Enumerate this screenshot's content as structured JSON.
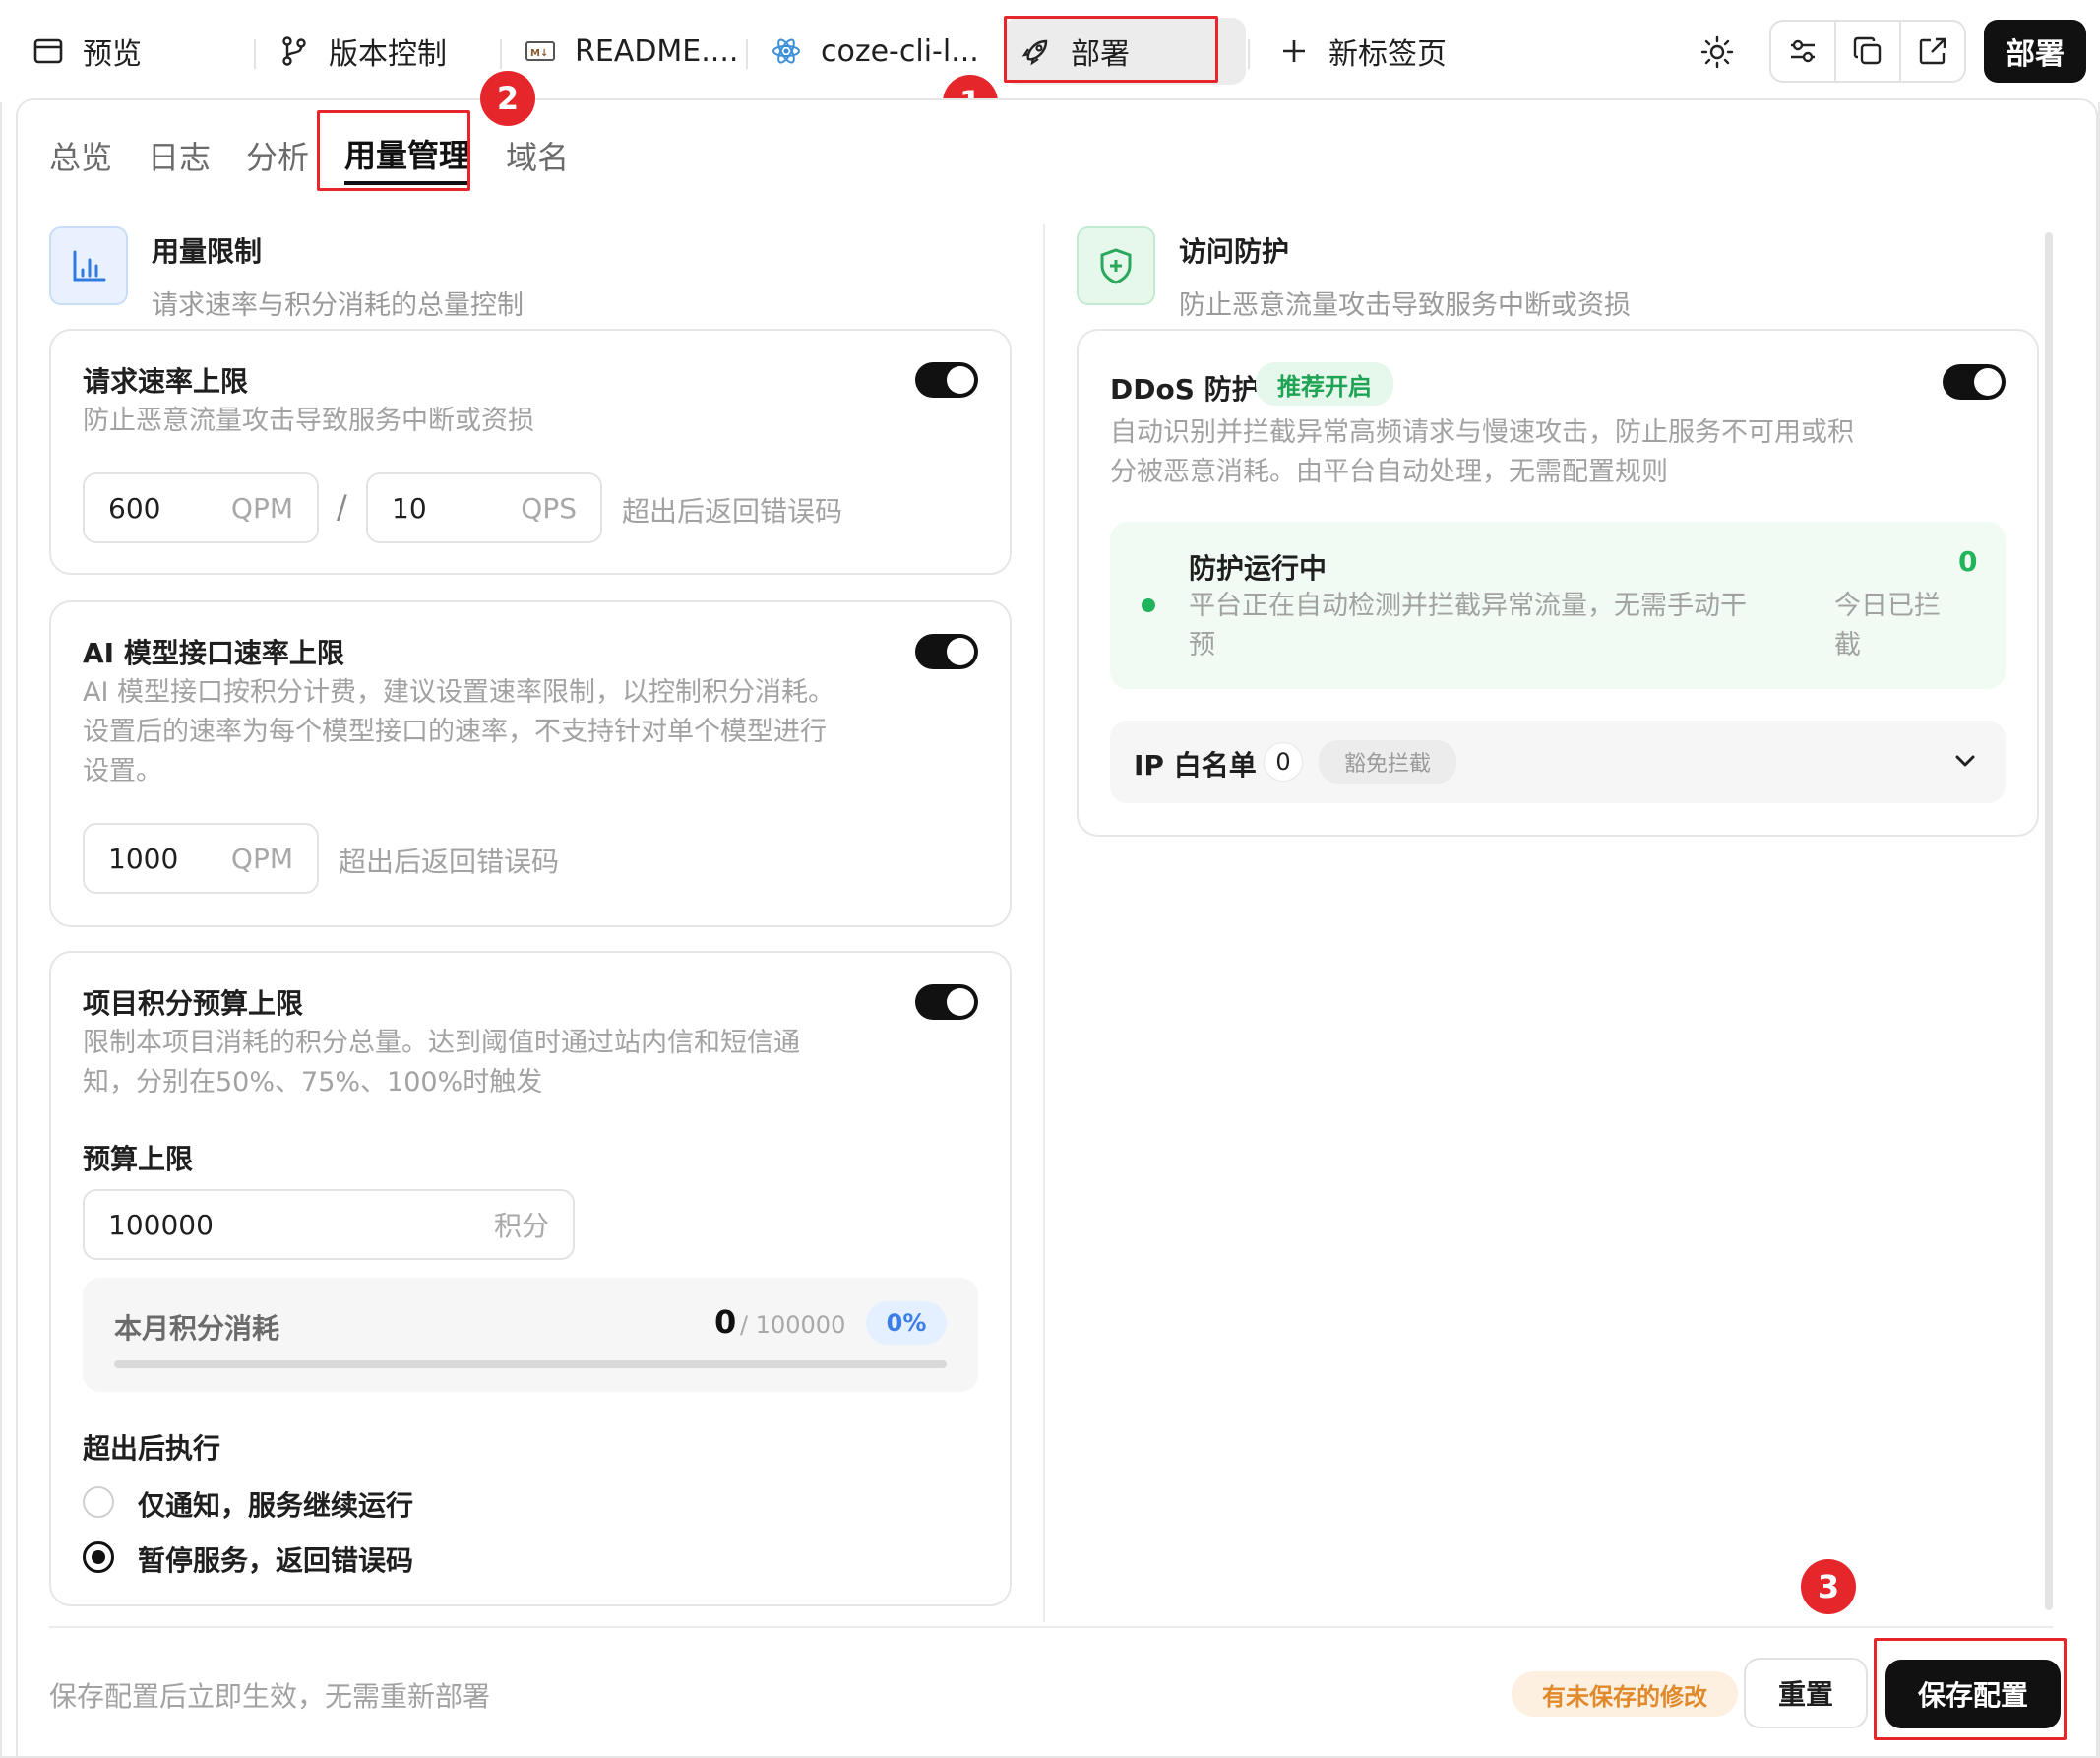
{
  "top_tabs": [
    {
      "label": "预览",
      "icon": "browser-window-icon"
    },
    {
      "label": "版本控制",
      "icon": "git-branch-icon"
    },
    {
      "label": "README....",
      "icon": "markdown-icon"
    },
    {
      "label": "coze-cli-l...",
      "icon": "react-atom-icon"
    },
    {
      "label": "部署",
      "icon": "rocket-icon",
      "active": true
    },
    {
      "label": "新标签页",
      "icon": "plus-icon"
    }
  ],
  "toolbar": {
    "deploy_label": "部署"
  },
  "annotations": {
    "badge1": "1",
    "badge2": "2",
    "badge3": "3"
  },
  "sub_tabs": [
    "总览",
    "日志",
    "分析",
    "用量管理",
    "域名"
  ],
  "usage": {
    "title": "用量限制",
    "desc": "请求速率与积分消耗的总量控制",
    "request_rate": {
      "title": "请求速率上限",
      "desc": "防止恶意流量攻击导致服务中断或资损",
      "qpm_value": "600",
      "qpm_unit": "QPM",
      "separator": "/",
      "qps_value": "10",
      "qps_unit": "QPS",
      "hint": "超出后返回错误码"
    },
    "ai_rate": {
      "title": "AI 模型接口速率上限",
      "desc_lines": [
        "AI 模型接口按积分计费，建议设置速率限制，以控制积分消耗。",
        "设置后的速率为每个模型接口的速率，不支持针对单个模型进行",
        "设置。"
      ],
      "qpm_value": "1000",
      "qpm_unit": "QPM",
      "hint": "超出后返回错误码"
    },
    "budget": {
      "title": "项目积分预算上限",
      "desc_lines": [
        "限制本项目消耗的积分总量。达到阈值时通过站内信和短信通",
        "知，分别在50%、75%、100%时触发"
      ],
      "limit_label": "预算上限",
      "limit_value": "100000",
      "limit_unit": "积分",
      "month_label": "本月积分消耗",
      "used": "0",
      "total": "/ 100000",
      "percent": "0%",
      "progress": 0,
      "exceed_label": "超出后执行",
      "options": [
        "仅通知，服务继续运行",
        "暂停服务，返回错误码"
      ],
      "selected_option": 1
    }
  },
  "protection": {
    "title": "访问防护",
    "desc": "防止恶意流量攻击导致服务中断或资损",
    "ddos": {
      "title": "DDoS 防护",
      "badge": "推荐开启",
      "desc_lines": [
        "自动识别并拦截异常高频请求与慢速攻击，防止服务不可用或积",
        "分被恶意消耗。由平台自动处理，无需配置规则"
      ],
      "status_title": "防护运行中",
      "status_desc_lines": [
        "平台正在自动检测并拦截异常流量，无需手动干",
        "预"
      ],
      "blocked_count": "0",
      "blocked_label_lines": [
        "今日已拦",
        "截"
      ]
    },
    "whitelist": {
      "title": "IP 白名单",
      "count": "0",
      "badge": "豁免拦截"
    }
  },
  "footer": {
    "note": "保存配置后立即生效，无需重新部署",
    "unsaved": "有未保存的修改",
    "reset": "重置",
    "save": "保存配置"
  },
  "colors": {
    "accent": "#111111",
    "annotation_red": "#e5262a",
    "success_green": "#1fa354",
    "progress_blue": "#1677ff"
  }
}
